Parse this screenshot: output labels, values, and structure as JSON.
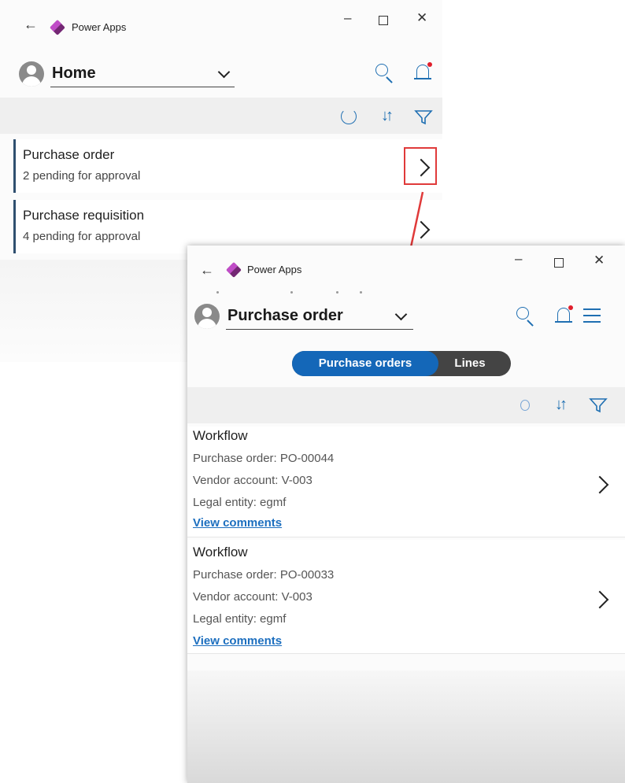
{
  "win1": {
    "title": "Power Apps",
    "header": {
      "dropdown_label": "Home"
    },
    "cards": [
      {
        "title": "Purchase order",
        "subtitle": "2 pending for approval"
      },
      {
        "title": "Purchase requisition",
        "subtitle": "4 pending for approval"
      }
    ]
  },
  "win2": {
    "title": "Power Apps",
    "header": {
      "dropdown_label": "Purchase order"
    },
    "toggle": {
      "active": "Purchase orders",
      "inactive": "Lines"
    },
    "workflows": [
      {
        "title": "Workflow",
        "po": "Purchase order: PO-00044",
        "vendor": "Vendor account: V-003",
        "entity": "Legal entity: egmf",
        "link": "View comments"
      },
      {
        "title": "Workflow",
        "po": "Purchase order: PO-00033",
        "vendor": "Vendor account: V-003",
        "entity": "Legal entity: egmf",
        "link": "View comments"
      }
    ]
  },
  "colors": {
    "accent": "#1f6fb2",
    "toggle_active": "#1467b8",
    "highlight": "#e03a3a",
    "notification_dot": "#e01e2b"
  },
  "icons": [
    "back-arrow-icon",
    "power-apps-logo-icon",
    "minimize-icon",
    "maximize-icon",
    "close-icon",
    "search-icon",
    "bell-icon",
    "menu-icon",
    "refresh-icon",
    "sort-icon",
    "filter-icon",
    "chevron-right-icon",
    "chevron-down-icon"
  ]
}
